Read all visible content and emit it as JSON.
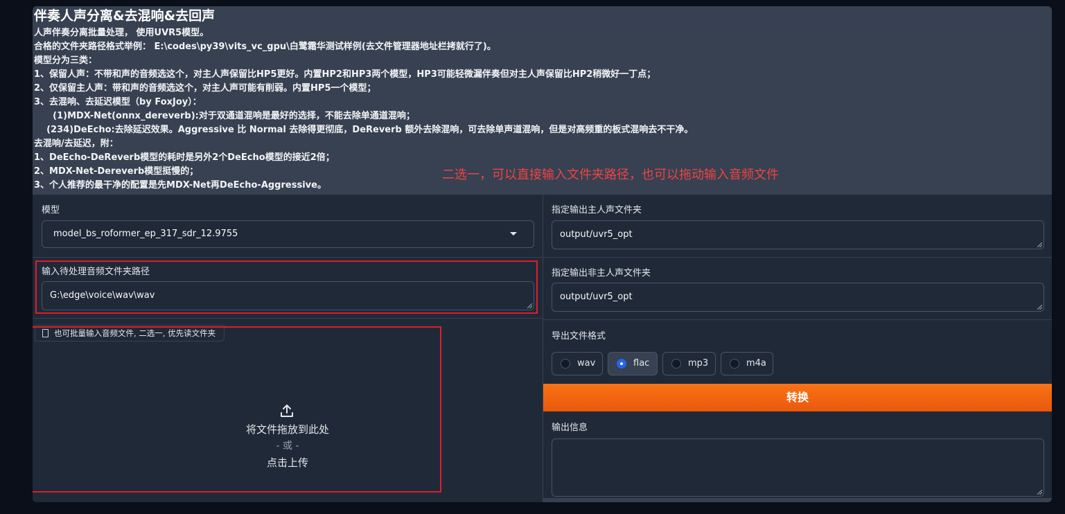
{
  "header": {
    "title": "伴奏人声分离&去混响&去回声",
    "lines": [
      "人声伴奏分离批量处理， 使用UVR5模型。",
      "合格的文件夹路径格式举例： E:\\codes\\py39\\vits_vc_gpu\\白鹭霜华测试样例(去文件管理器地址栏拷就行了)。",
      "模型分为三类：",
      "1、保留人声：不带和声的音频选这个，对主人声保留比HP5更好。内置HP2和HP3两个模型，HP3可能轻微漏伴奏但对主人声保留比HP2稍微好一丁点；",
      "2、仅保留主人声：带和声的音频选这个，对主人声可能有削弱。内置HP5一个模型；",
      "3、去混响、去延迟模型（by FoxJoy）：",
      "      (1)MDX-Net(onnx_dereverb):对于双通道混响是最好的选择，不能去除单通道混响；",
      "    (234)DeEcho:去除延迟效果。Aggressive 比 Normal 去除得更彻底，DeReverb 额外去除混响，可去除单声道混响，但是对高频重的板式混响去不干净。",
      "去混响/去延迟，附：",
      "1、DeEcho-DeReverb模型的耗时是另外2个DeEcho模型的接近2倍；",
      "2、MDX-Net-Dereverb模型挺慢的；",
      "3、个人推荐的最干净的配置是先MDX-Net再DeEcho-Aggressive。"
    ]
  },
  "annotation": "二选一，可以直接输入文件夹路径，也可以拖动输入音频文件",
  "left": {
    "model_label": "模型",
    "model_value": "model_bs_roformer_ep_317_sdr_12.9755",
    "input_dir_label": "输入待处理音频文件夹路径",
    "input_dir_value": "G:\\edge\\voice\\wav\\wav",
    "file_tag": "也可批量输入音频文件, 二选一, 优先读文件夹",
    "upload_drop": "将文件拖放到此处",
    "upload_or": "- 或 -",
    "upload_click": "点击上传"
  },
  "right": {
    "vocal_label": "指定输出主人声文件夹",
    "vocal_value": "output/uvr5_opt",
    "inst_label": "指定输出非主人声文件夹",
    "inst_value": "output/uvr5_opt",
    "format_label": "导出文件格式",
    "formats": [
      "wav",
      "flac",
      "mp3",
      "m4a"
    ],
    "selected_format": "flac",
    "convert_label": "转换",
    "output_label": "输出信息",
    "output_value": ""
  },
  "colors": {
    "accent_orange": "#f97316",
    "annotation_red": "#ef4444",
    "radio_selected": "#2563eb"
  }
}
